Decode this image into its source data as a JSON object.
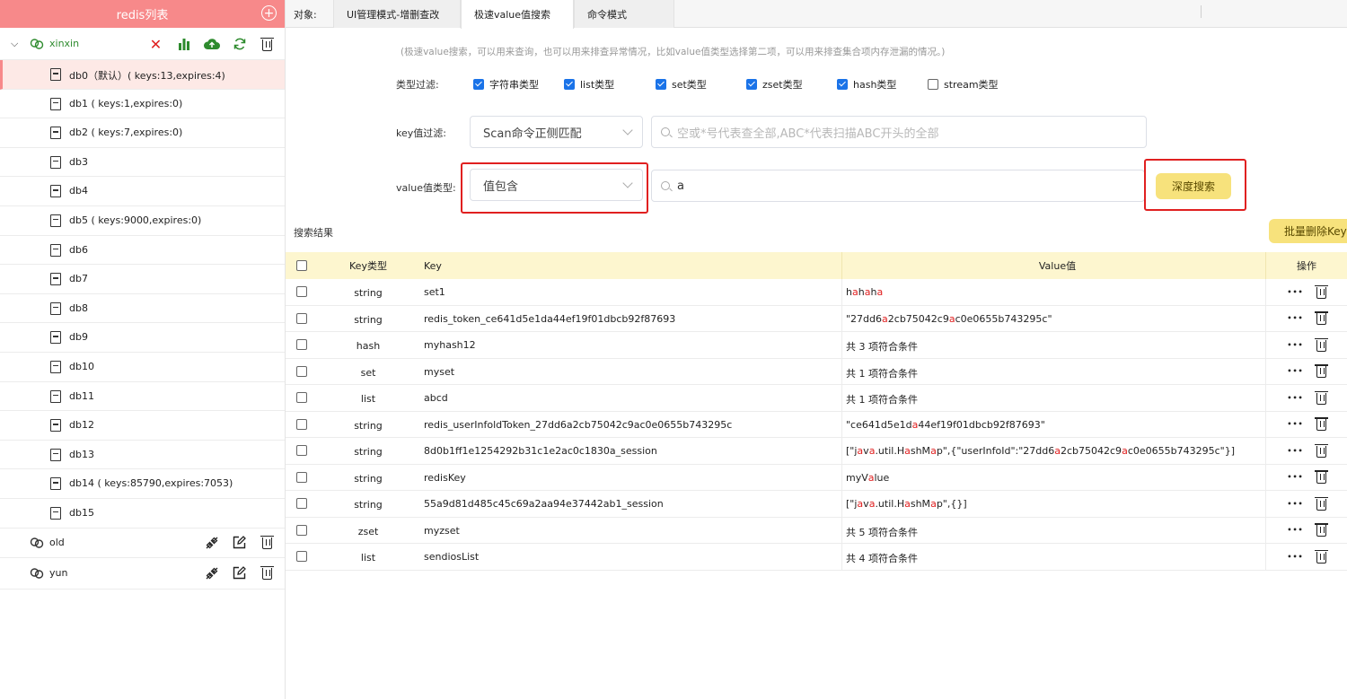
{
  "sidebar": {
    "title": "redis列表",
    "add_icon": "plus-circle-icon",
    "connections": [
      {
        "name": "xinxin",
        "expanded": true,
        "active_color": "#2e8b2e"
      },
      {
        "name": "old"
      },
      {
        "name": "yun"
      }
    ],
    "dbs": [
      "db0（默认）( keys:13,expires:4)",
      "db1 ( keys:1,expires:0)",
      "db2 ( keys:7,expires:0)",
      "db3",
      "db4",
      "db5 ( keys:9000,expires:0)",
      "db6",
      "db7",
      "db8",
      "db9",
      "db10",
      "db11",
      "db12",
      "db13",
      "db14 ( keys:85790,expires:7053)",
      "db15"
    ]
  },
  "topbar": {
    "object_label": "对象:",
    "tabs": [
      "UI管理模式-增删查改",
      "极速value值搜索",
      "命令模式"
    ],
    "active_tab": 1
  },
  "search": {
    "hint": "(极速value搜索，可以用来查询，也可以用来排查异常情况，比如value值类型选择第二项，可以用来排查集合项内存泄漏的情况。)",
    "type_filter_label": "类型过滤:",
    "types": [
      {
        "label": "字符串类型",
        "checked": true
      },
      {
        "label": "list类型",
        "checked": true
      },
      {
        "label": "set类型",
        "checked": true
      },
      {
        "label": "zset类型",
        "checked": true
      },
      {
        "label": "hash类型",
        "checked": true
      },
      {
        "label": "stream类型",
        "checked": false
      }
    ],
    "key_filter_label": "key值过滤:",
    "key_mode": "Scan命令正侧匹配",
    "key_placeholder": "空或*号代表查全部,ABC*代表扫描ABC开头的全部",
    "value_type_label": "value值类型:",
    "value_mode": "值包含",
    "value_input": "a",
    "deep_search_label": "深度搜索",
    "results_label": "搜索结果",
    "batch_delete_label": "批量删除Key"
  },
  "table": {
    "headers": {
      "type": "Key类型",
      "key": "Key",
      "value": "Value值",
      "ops": "操作"
    },
    "rows": [
      {
        "type": "string",
        "key": "set1",
        "value": [
          "h",
          "a",
          "h",
          "a",
          "h",
          "a"
        ],
        "hl": [
          1,
          3,
          5
        ]
      },
      {
        "type": "string",
        "key": "redis_token_ce641d5e1da44ef19f01dbcb92f87693",
        "value": [
          "\"27dd6",
          "a",
          "2cb75042c9",
          "a",
          "c0e0655b743295c\""
        ],
        "hl": [
          1,
          3
        ]
      },
      {
        "type": "hash",
        "key": "myhash12",
        "value": [
          "共 3 项符合条件"
        ],
        "hl": []
      },
      {
        "type": "set",
        "key": "myset",
        "value": [
          "共 1 项符合条件"
        ],
        "hl": []
      },
      {
        "type": "list",
        "key": "abcd",
        "value": [
          "共 1 项符合条件"
        ],
        "hl": []
      },
      {
        "type": "string",
        "key": "redis_userInfoldToken_27dd6a2cb75042c9ac0e0655b743295c",
        "value": [
          "\"ce641d5e1d",
          "a",
          "44ef19f01dbcb92f87693\""
        ],
        "hl": [
          1
        ]
      },
      {
        "type": "string",
        "key": "8d0b1ff1e1254292b31c1e2ac0c1830a_session",
        "value": [
          "[\"j",
          "a",
          "v",
          "a",
          ".util.H",
          "a",
          "shM",
          "a",
          "p\",{\"userInfoId\":\"27dd6",
          "a",
          "2cb75042c9",
          "a",
          "c0e0655b743295c\"}]"
        ],
        "hl": [
          1,
          3,
          5,
          7,
          9,
          11
        ]
      },
      {
        "type": "string",
        "key": "redisKey",
        "value": [
          "myV",
          "a",
          "lue"
        ],
        "hl": [
          1
        ]
      },
      {
        "type": "string",
        "key": "55a9d81d485c45c69a2aa94e37442ab1_session",
        "value": [
          "[\"j",
          "a",
          "v",
          "a",
          ".util.H",
          "a",
          "shM",
          "a",
          "p\",{}]"
        ],
        "hl": [
          1,
          3,
          5,
          7
        ]
      },
      {
        "type": "zset",
        "key": "myzset",
        "value": [
          "共 5 项符合条件"
        ],
        "hl": []
      },
      {
        "type": "list",
        "key": "sendiosList",
        "value": [
          "共 4 项符合条件"
        ],
        "hl": []
      }
    ]
  },
  "colors": {
    "brand": "#f7898a",
    "checkbox": "#1a73e8",
    "highlight": "#e02020",
    "button": "#f7e27c"
  }
}
